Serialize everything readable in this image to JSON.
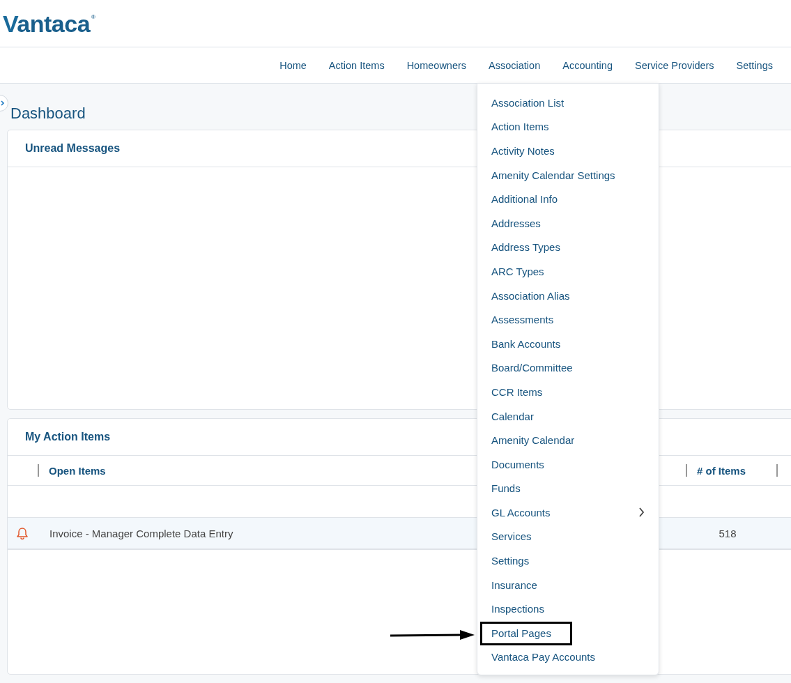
{
  "logo": {
    "text": "Vantaca",
    "mark": "®"
  },
  "nav": [
    "Home",
    "Action Items",
    "Homeowners",
    "Association",
    "Accounting",
    "Service Providers",
    "Settings"
  ],
  "page_title": "Dashboard",
  "unread_messages": {
    "title": "Unread Messages"
  },
  "action_items": {
    "title": "My Action Items",
    "columns": [
      "Open Items",
      "# of Items"
    ],
    "rows": [
      {
        "name": "Invoice - Manager Complete Data Entry",
        "count": "518"
      }
    ]
  },
  "association_menu": [
    {
      "label": "Association List",
      "has_submenu": false,
      "highlighted": false
    },
    {
      "label": "Action Items",
      "has_submenu": false,
      "highlighted": false
    },
    {
      "label": "Activity Notes",
      "has_submenu": false,
      "highlighted": false
    },
    {
      "label": "Amenity Calendar Settings",
      "has_submenu": false,
      "highlighted": false
    },
    {
      "label": "Additional Info",
      "has_submenu": false,
      "highlighted": false
    },
    {
      "label": "Addresses",
      "has_submenu": false,
      "highlighted": false
    },
    {
      "label": "Address Types",
      "has_submenu": false,
      "highlighted": false
    },
    {
      "label": "ARC Types",
      "has_submenu": false,
      "highlighted": false
    },
    {
      "label": "Association Alias",
      "has_submenu": false,
      "highlighted": false
    },
    {
      "label": "Assessments",
      "has_submenu": false,
      "highlighted": false
    },
    {
      "label": "Bank Accounts",
      "has_submenu": false,
      "highlighted": false
    },
    {
      "label": "Board/Committee",
      "has_submenu": false,
      "highlighted": false
    },
    {
      "label": "CCR Items",
      "has_submenu": false,
      "highlighted": false
    },
    {
      "label": "Calendar",
      "has_submenu": false,
      "highlighted": false
    },
    {
      "label": "Amenity Calendar",
      "has_submenu": false,
      "highlighted": false
    },
    {
      "label": "Documents",
      "has_submenu": false,
      "highlighted": false
    },
    {
      "label": "Funds",
      "has_submenu": false,
      "highlighted": false
    },
    {
      "label": "GL Accounts",
      "has_submenu": true,
      "highlighted": false
    },
    {
      "label": "Services",
      "has_submenu": false,
      "highlighted": false
    },
    {
      "label": "Settings",
      "has_submenu": false,
      "highlighted": false
    },
    {
      "label": "Insurance",
      "has_submenu": false,
      "highlighted": false
    },
    {
      "label": "Inspections",
      "has_submenu": false,
      "highlighted": false
    },
    {
      "label": "Portal Pages",
      "has_submenu": false,
      "highlighted": true
    },
    {
      "label": "Vantaca Pay Accounts",
      "has_submenu": false,
      "highlighted": false
    }
  ]
}
